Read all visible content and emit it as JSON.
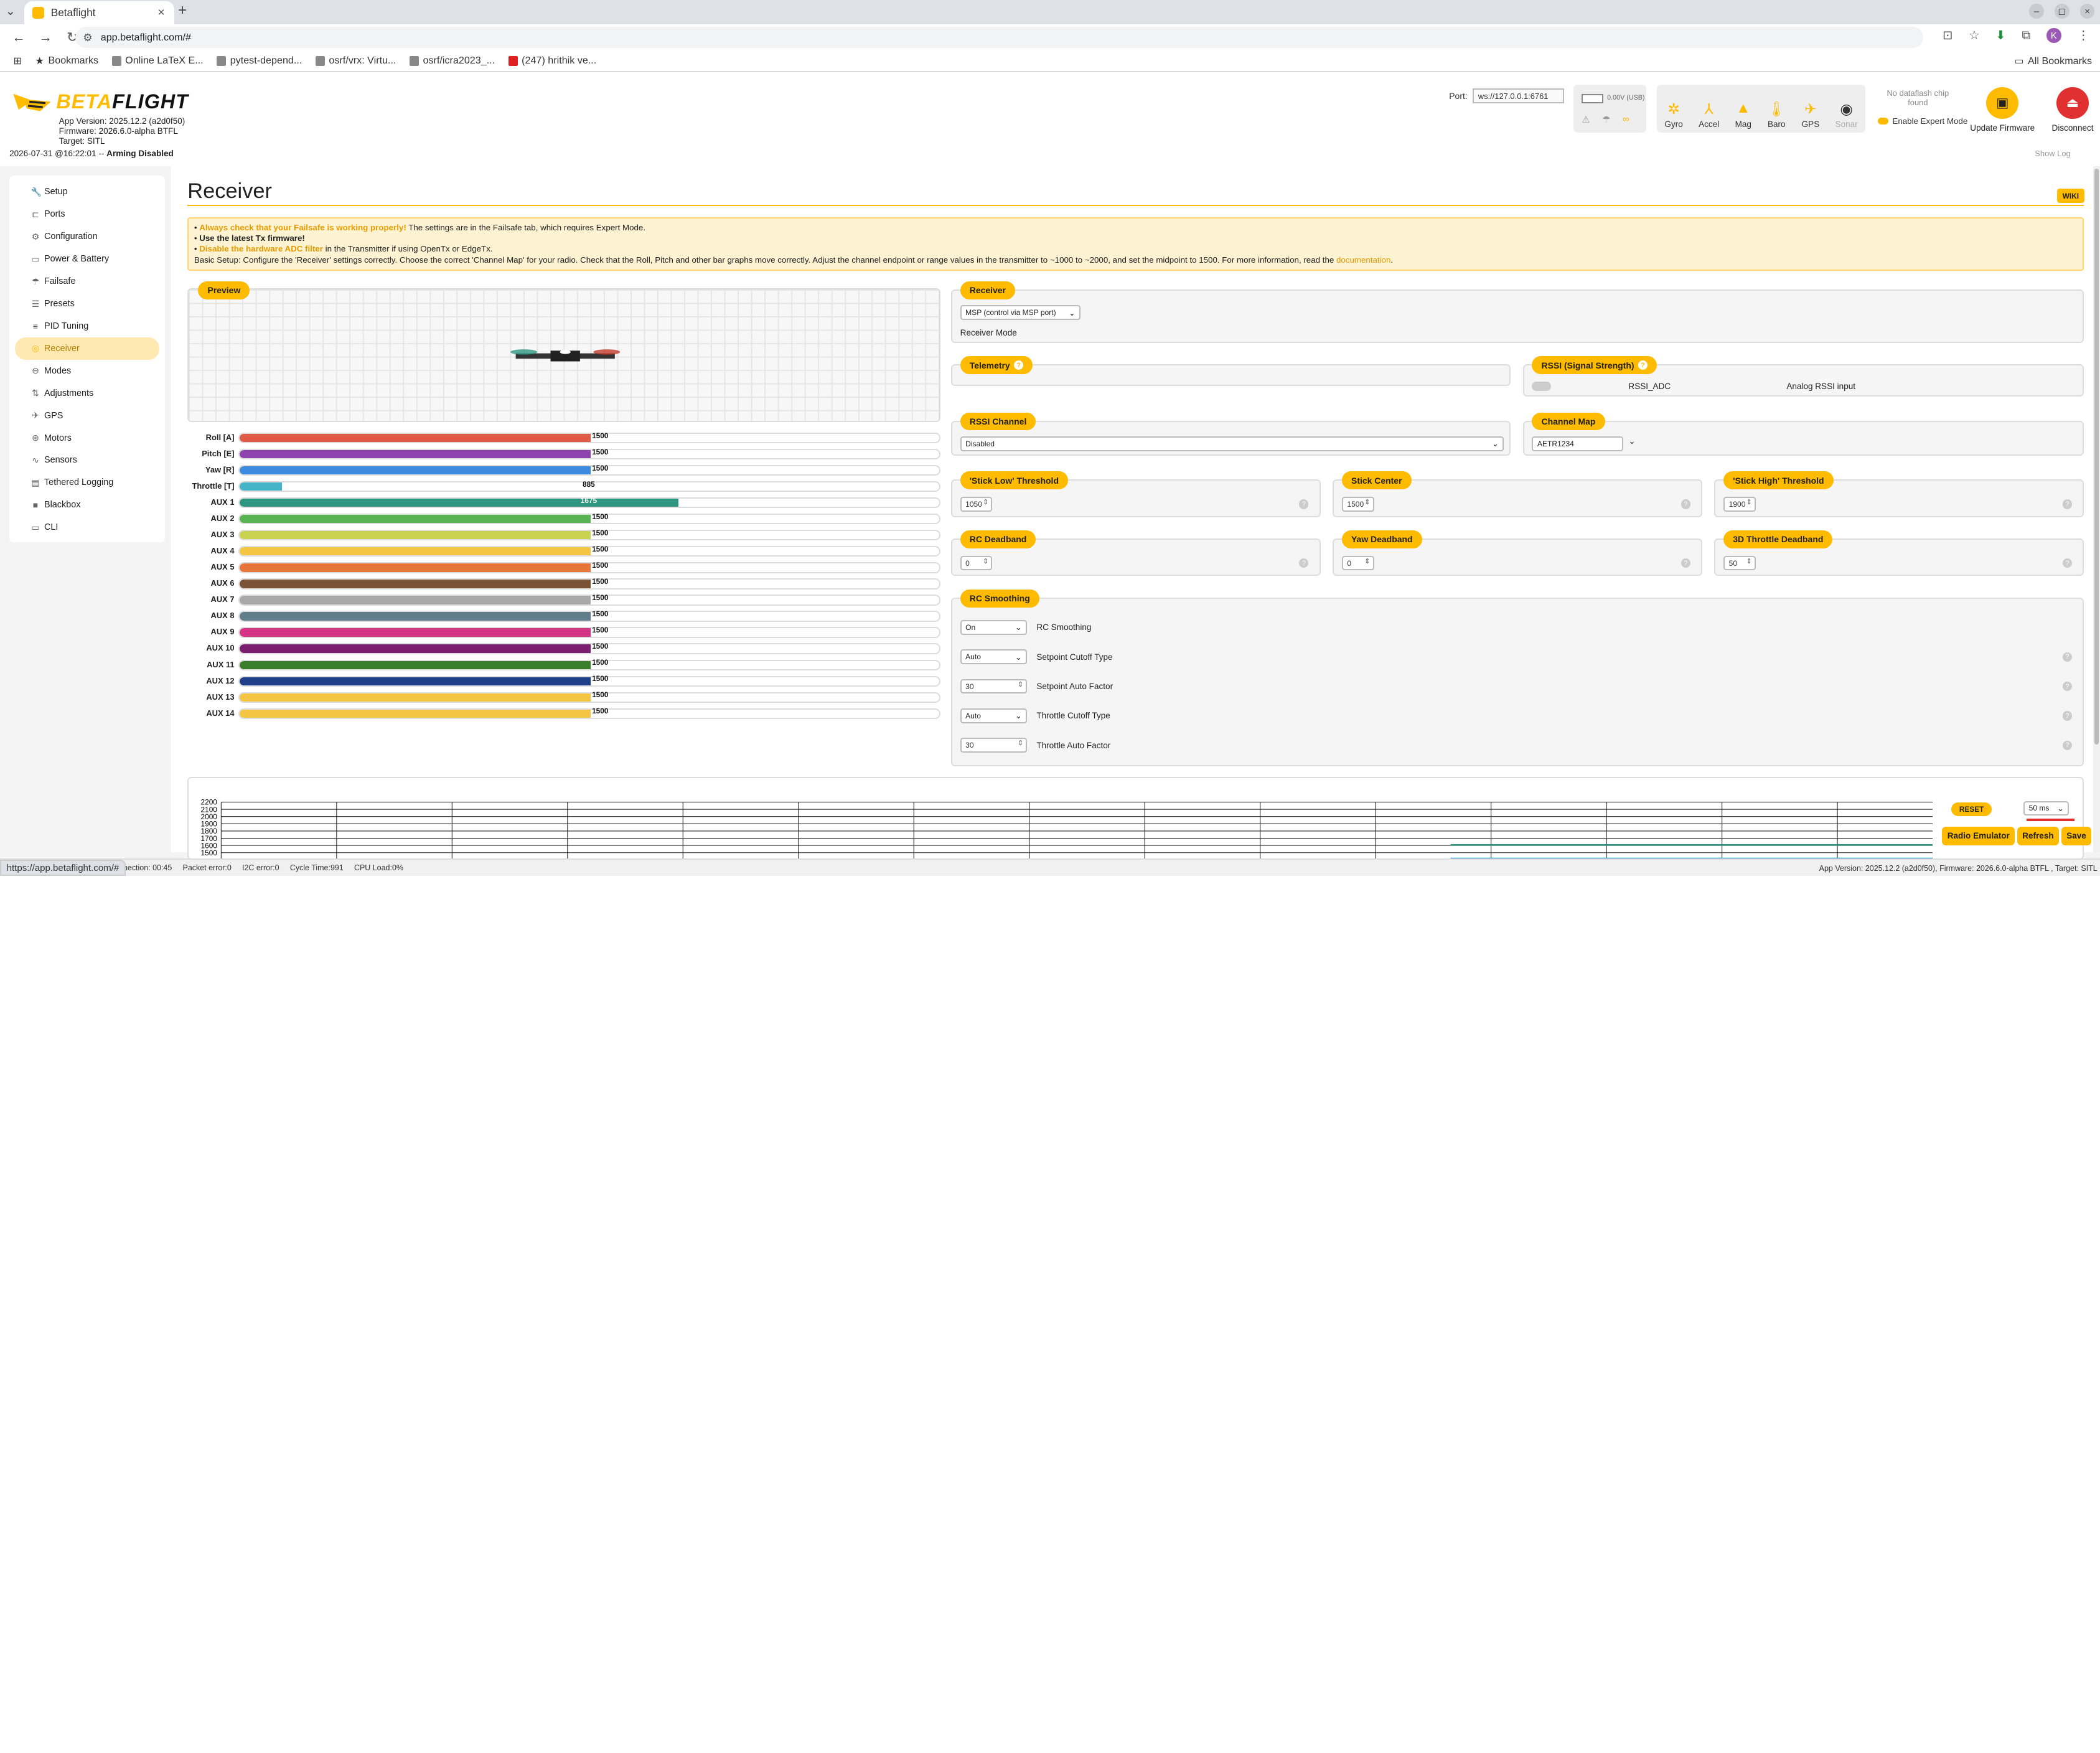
{
  "browser": {
    "tab_title": "Betaflight",
    "url": "app.betaflight.com/#",
    "status_url": "https://app.betaflight.com/#",
    "profile_initial": "K",
    "bookmarks": [
      "Bookmarks",
      "Online LaTeX E...",
      "pytest-depend...",
      "osrf/vrx: Virtu...",
      "osrf/icra2023_...",
      "(247) hrithik ve..."
    ],
    "all_bookmarks": "All Bookmarks"
  },
  "header": {
    "logo_a": "BETA",
    "logo_b": "FLIGHT",
    "app_version": "App Version: 2025.12.2 (a2d0f50)",
    "firmware": "Firmware: 2026.6.0-alpha BTFL",
    "target": "Target: SITL",
    "date": "2026-07-31 @16:22:01 -- ",
    "arming": "Arming Disabled",
    "port_label": "Port:",
    "port_value": "ws://127.0.0.1:6761",
    "battery": "0.00V (USB)",
    "sensors": [
      "Gyro",
      "Accel",
      "Mag",
      "Baro",
      "GPS",
      "Sonar"
    ],
    "dataflash": "No dataflash chip found",
    "expert_mode": "Enable Expert Mode",
    "update_firmware": "Update Firmware",
    "disconnect": "Disconnect",
    "show_log": "Show Log"
  },
  "sidebar": {
    "items": [
      "Setup",
      "Ports",
      "Configuration",
      "Power & Battery",
      "Failsafe",
      "Presets",
      "PID Tuning",
      "Receiver",
      "Modes",
      "Adjustments",
      "GPS",
      "Motors",
      "Sensors",
      "Tethered Logging",
      "Blackbox",
      "CLI"
    ],
    "active_index": 7
  },
  "page": {
    "title": "Receiver",
    "wiki": "WIKI",
    "note_1_hl": "Always check that your Failsafe is working properly!",
    "note_1_rest": " The settings are in the Failsafe tab, which requires Expert Mode.",
    "note_2": "Use the latest Tx firmware!",
    "note_3_hl": "Disable the hardware ADC filter",
    "note_3_rest": " in the Transmitter if using OpenTx or EdgeTx.",
    "note_4": "Basic Setup: Configure the 'Receiver' settings correctly. Choose the correct 'Channel Map' for your radio. Check that the Roll, Pitch and other bar graphs move correctly. Adjust the channel endpoint or range values in the transmitter to ~1000 to ~2000, and set the midpoint to 1500. For more information, read the ",
    "note_4_link": "documentation",
    "note_4_end": "."
  },
  "preview": {
    "label": "Preview"
  },
  "channels": [
    {
      "name": "Roll [A]",
      "value": 1500,
      "color": "#e05a45"
    },
    {
      "name": "Pitch [E]",
      "value": 1500,
      "color": "#8e44ad"
    },
    {
      "name": "Yaw [R]",
      "value": 1500,
      "color": "#3d8be0"
    },
    {
      "name": "Throttle [T]",
      "value": 885,
      "color": "#45b3c8"
    },
    {
      "name": "AUX 1",
      "value": 1675,
      "color": "#2e9680"
    },
    {
      "name": "AUX 2",
      "value": 1500,
      "color": "#59b352"
    },
    {
      "name": "AUX 3",
      "value": 1500,
      "color": "#c9d34f"
    },
    {
      "name": "AUX 4",
      "value": 1500,
      "color": "#f4c542"
    },
    {
      "name": "AUX 5",
      "value": 1500,
      "color": "#e8753a"
    },
    {
      "name": "AUX 6",
      "value": 1500,
      "color": "#7a5236"
    },
    {
      "name": "AUX 7",
      "value": 1500,
      "color": "#a8a8a8"
    },
    {
      "name": "AUX 8",
      "value": 1500,
      "color": "#607d8b"
    },
    {
      "name": "AUX 9",
      "value": 1500,
      "color": "#d63384"
    },
    {
      "name": "AUX 10",
      "value": 1500,
      "color": "#7b1e6f"
    },
    {
      "name": "AUX 11",
      "value": 1500,
      "color": "#3a7d2a"
    },
    {
      "name": "AUX 12",
      "value": 1500,
      "color": "#1f3f8a"
    },
    {
      "name": "AUX 13",
      "value": 1500,
      "color": "#f4c542"
    },
    {
      "name": "AUX 14",
      "value": 1500,
      "color": "#f4c542"
    }
  ],
  "receiver": {
    "label": "Receiver",
    "mode_value": "MSP (control via MSP port)",
    "mode_label": "Receiver Mode"
  },
  "telemetry": {
    "label": "Telemetry"
  },
  "rssi": {
    "label": "RSSI (Signal Strength)",
    "toggle_label": "RSSI_ADC",
    "analog_label": "Analog RSSI input"
  },
  "rssi_channel": {
    "label": "RSSI Channel",
    "value": "Disabled"
  },
  "channel_map": {
    "label": "Channel Map",
    "value": "AETR1234"
  },
  "thresholds": {
    "stick_low": {
      "label": "'Stick Low' Threshold",
      "value": "1050"
    },
    "stick_center": {
      "label": "Stick Center",
      "value": "1500"
    },
    "stick_high": {
      "label": "'Stick High' Threshold",
      "value": "1900"
    },
    "rc_deadband": {
      "label": "RC Deadband",
      "value": "0"
    },
    "yaw_deadband": {
      "label": "Yaw Deadband",
      "value": "0"
    },
    "throttle_3d": {
      "label": "3D Throttle Deadband",
      "value": "50"
    }
  },
  "smoothing": {
    "label": "RC Smoothing",
    "rows": [
      {
        "value": "On",
        "label": "RC Smoothing",
        "kind": "select"
      },
      {
        "value": "Auto",
        "label": "Setpoint Cutoff Type",
        "kind": "select"
      },
      {
        "value": "30",
        "label": "Setpoint Auto Factor",
        "kind": "num"
      },
      {
        "value": "Auto",
        "label": "Throttle Cutoff Type",
        "kind": "select"
      },
      {
        "value": "30",
        "label": "Throttle Auto Factor",
        "kind": "num"
      }
    ]
  },
  "graph": {
    "y_ticks": [
      "2200",
      "2100",
      "2000",
      "1900",
      "1800",
      "1700",
      "1600",
      "1500"
    ],
    "reset": "RESET",
    "interval": "50 ms"
  },
  "actions": {
    "radio_emulator": "Radio Emulator",
    "refresh": "Refresh",
    "save": "Save"
  },
  "statusbar": {
    "connection": "nection: 00:45",
    "packet_error": "Packet error:0",
    "i2c_error": "I2C error:0",
    "cycle_time": "Cycle Time:991",
    "cpu_load": "CPU Load:0%",
    "version": "App Version: 2025.12.2 (a2d0f50), Firmware: 2026.6.0-alpha BTFL , Target: SITL"
  },
  "colors": {
    "accent": "#ffbb00",
    "disconnect": "#e03030"
  }
}
